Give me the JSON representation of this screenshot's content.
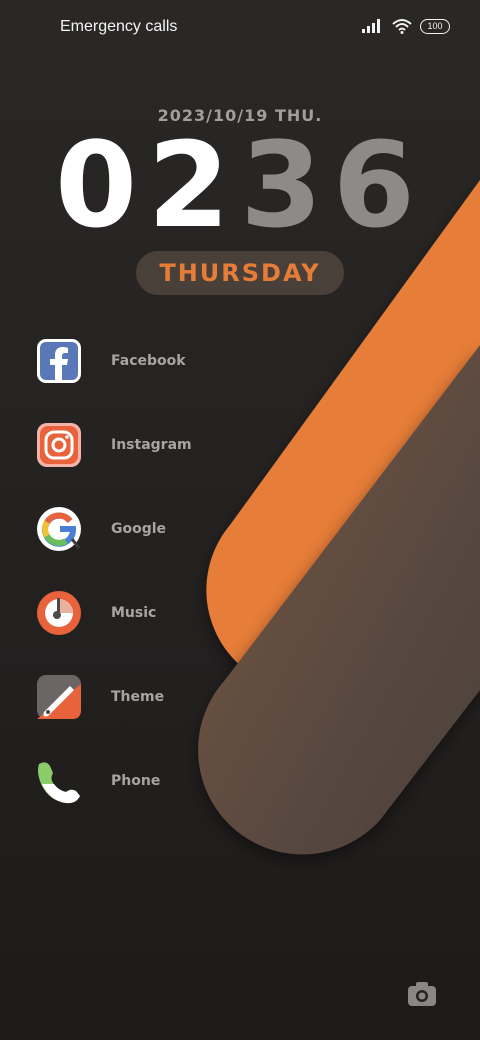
{
  "status_bar": {
    "carrier_text": "Emergency calls o",
    "battery": "100"
  },
  "lockscreen": {
    "date": "2023/10/19 THU.",
    "time_digits": [
      "0",
      "2",
      "3",
      "6"
    ],
    "day": "THURSDAY"
  },
  "apps": [
    {
      "label": "Facebook",
      "icon": "facebook-icon"
    },
    {
      "label": "Instagram",
      "icon": "instagram-icon"
    },
    {
      "label": "Google",
      "icon": "google-icon"
    },
    {
      "label": "Music",
      "icon": "music-icon"
    },
    {
      "label": "Theme",
      "icon": "theme-icon"
    },
    {
      "label": "Phone",
      "icon": "phone-icon"
    }
  ],
  "colors": {
    "accent_orange": "#e67d38",
    "band_brown": "#6b5446",
    "background": "#262322"
  },
  "camera": {
    "icon": "camera-icon"
  }
}
